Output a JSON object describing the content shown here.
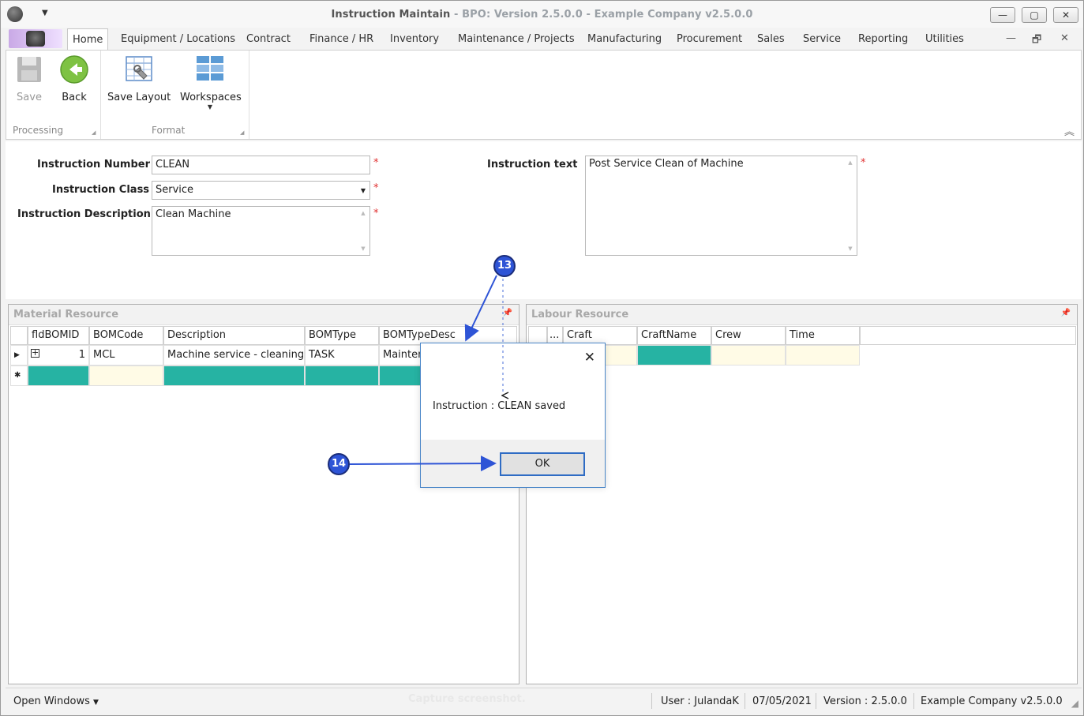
{
  "window": {
    "title": "Instruction Maintain",
    "subtitle": " - BPO: Version 2.5.0.0 - Example Company v2.5.0.0",
    "controls": {
      "minimize": "—",
      "restore": "▢",
      "close": "✕"
    }
  },
  "qat": {
    "dropdown_glyph": "▼"
  },
  "ribbon_tabs": {
    "home": "Home",
    "equipment": "Equipment / Locations",
    "contract": "Contract",
    "finance": "Finance / HR",
    "inventory": "Inventory",
    "maintenance": "Maintenance / Projects",
    "manufacturing": "Manufacturing",
    "procurement": "Procurement",
    "sales": "Sales",
    "service": "Service",
    "reporting": "Reporting",
    "utilities": "Utilities"
  },
  "mdi_controls": {
    "minimize": "—",
    "restore": "🗗",
    "close": "✕"
  },
  "ribbon": {
    "save": "Save",
    "back": "Back",
    "save_layout": "Save Layout",
    "workspaces": "Workspaces",
    "group_processing": "Processing",
    "group_format": "Format",
    "icons": [
      "floppy-icon",
      "back-arrow-icon",
      "layout-wrench-icon",
      "workspaces-grid-icon"
    ]
  },
  "form": {
    "instruction_number_label": "Instruction Number",
    "instruction_number_value": "CLEAN",
    "instruction_class_label": "Instruction Class",
    "instruction_class_value": "Service",
    "instruction_description_label": "Instruction Description",
    "instruction_description_value": "Clean Machine",
    "instruction_text_label": "Instruction text",
    "instruction_text_value": "Post Service Clean of Machine",
    "required_mark": "*"
  },
  "material_resource": {
    "title": "Material Resource",
    "columns": [
      "fldBOMID",
      "BOMCode",
      "Description",
      "BOMType",
      "BOMTypeDesc"
    ],
    "rows": [
      {
        "id": "1",
        "code": "MCL",
        "description": "Machine service - cleaning",
        "type": "TASK",
        "type_desc": "Mainten"
      }
    ],
    "new_row_glyph": "✱"
  },
  "labour_resource": {
    "title": "Labour Resource",
    "columns": [
      "...",
      "Craft",
      "CraftName",
      "Crew",
      "Time"
    ]
  },
  "statusbar": {
    "open_windows": "Open Windows",
    "capture_hint": "Capture screenshot.",
    "user": "User : JulandaK",
    "date": "07/05/2021",
    "version": "Version : 2.5.0.0",
    "company": "Example Company v2.5.0.0"
  },
  "dialog": {
    "message": "Instruction : CLEAN saved",
    "ok": "OK",
    "close_glyph": "✕"
  },
  "callouts": {
    "step13": "13",
    "step14": "14"
  },
  "colors": {
    "accent_teal": "#26b3a3",
    "new_row_cream": "#fffbe6",
    "callout_blue": "#2e54d6",
    "required_red": "#e03030"
  }
}
